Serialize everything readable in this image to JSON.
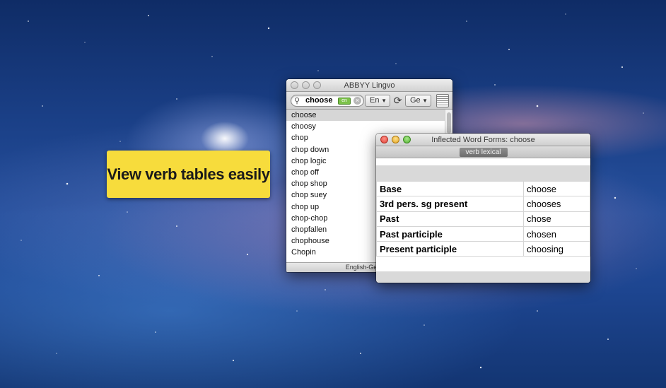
{
  "callout": {
    "text": "View verb tables easily"
  },
  "lingvo": {
    "title": "ABBYY Lingvo",
    "search_value": "choose",
    "source_lang": "En",
    "target_lang": "Ge",
    "keyboard_badge": "en",
    "words": [
      "choose",
      "choosy",
      "chop",
      "chop down",
      "chop logic",
      "chop off",
      "chop shop",
      "chop suey",
      "chop up",
      "chop-chop",
      "chopfallen",
      "chophouse",
      "Chopin"
    ],
    "selected_word": "choose",
    "status": "English-German:"
  },
  "inflected": {
    "title": "Inflected Word Forms: choose",
    "tag": "verb lexical",
    "rows": [
      {
        "label": "Base",
        "value": "choose"
      },
      {
        "label": "3rd pers. sg present",
        "value": "chooses"
      },
      {
        "label": "Past",
        "value": "chose"
      },
      {
        "label": "Past participle",
        "value": "chosen"
      },
      {
        "label": "Present participle",
        "value": "choosing"
      }
    ]
  },
  "colors": {
    "callout": "#f7dc3c",
    "selection": "#d6d6d6"
  },
  "icons": [
    "search-icon",
    "clear-icon",
    "swap-languages-icon",
    "dictionary-book-icon",
    "chevron-down-icon"
  ]
}
